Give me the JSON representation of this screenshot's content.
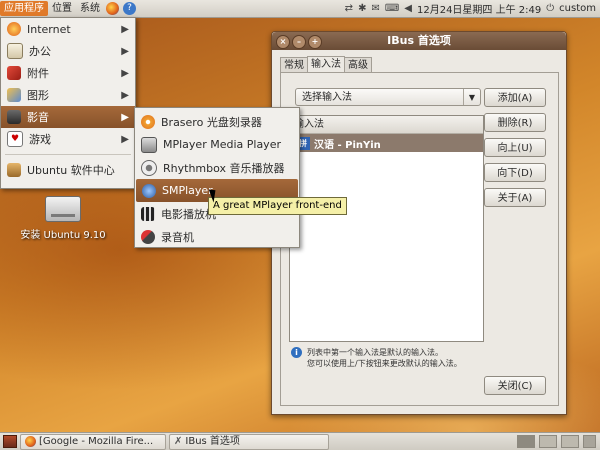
{
  "top_panel": {
    "menus": [
      "应用程序",
      "位置",
      "系统"
    ],
    "datetime": "12月24日星期四 上午 2:49",
    "user": "custom"
  },
  "main_menu": {
    "items": [
      {
        "label": "Internet",
        "icon": "globe-icon"
      },
      {
        "label": "办公",
        "icon": "office-icon"
      },
      {
        "label": "附件",
        "icon": "accessories-icon"
      },
      {
        "label": "图形",
        "icon": "graphics-icon"
      },
      {
        "label": "影音",
        "icon": "multimedia-icon"
      },
      {
        "label": "游戏",
        "icon": "games-icon"
      }
    ],
    "bottom_item": "Ubuntu 软件中心"
  },
  "submenu": {
    "items": [
      {
        "label": "Brasero 光盘刻录器",
        "icon": "disc-icon"
      },
      {
        "label": "MPlayer Media Player",
        "icon": "mplayer-icon"
      },
      {
        "label": "Rhythmbox 音乐播放器",
        "icon": "rhythmbox-icon"
      },
      {
        "label": "SMPlayer",
        "icon": "smplayer-icon"
      },
      {
        "label": "电影播放机",
        "icon": "film-icon"
      },
      {
        "label": "录音机",
        "icon": "microphone-icon"
      }
    ]
  },
  "tooltip": "A great MPlayer front-end",
  "desktop_icon": "安装 Ubuntu 9.10",
  "window": {
    "title": "IBus 首选项",
    "tabs": [
      "常规",
      "输入法",
      "高级"
    ],
    "combo": "选择输入法",
    "list_header": "输入法",
    "list_rows": [
      {
        "label": "汉语 - PinYin",
        "icon_text": "拼"
      }
    ],
    "buttons": {
      "add": "添加(A)",
      "remove": "删除(R)",
      "up": "向上(U)",
      "down": "向下(D)",
      "about": "关于(A)",
      "close": "关闭(C)"
    },
    "note_line1": "列表中第一个输入法是默认的输入法。",
    "note_line2": "您可以使用上/下按钮来更改默认的输入法。"
  },
  "taskbar": {
    "tasks": [
      "[Google - Mozilla Fire...",
      "IBus 首选项"
    ]
  },
  "colors": {
    "highlight": "#87522a",
    "accent": "#e07a2a"
  }
}
